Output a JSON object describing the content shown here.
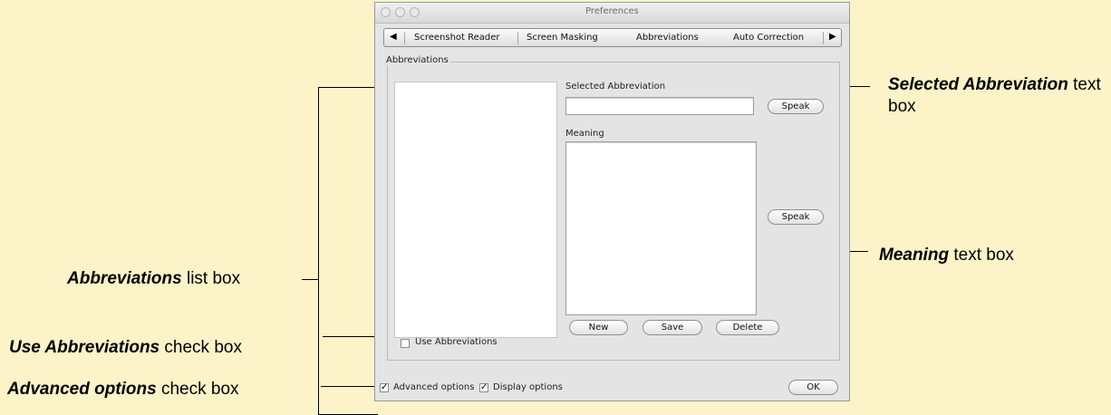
{
  "window": {
    "title": "Preferences",
    "tabs": [
      "Screenshot Reader",
      "Screen Masking",
      "Abbreviations",
      "Auto Correction"
    ],
    "tab_prev_icon": "◀",
    "tab_next_icon": "▶"
  },
  "group": {
    "label": "Abbreviations",
    "selected_label": "Selected Abbreviation",
    "selected_value": "",
    "meaning_label": "Meaning",
    "meaning_value": "",
    "speak_button": "Speak",
    "speak_button_2": "Speak",
    "new_button": "New",
    "save_button": "Save",
    "delete_button": "Delete",
    "use_abbreviations_label": "Use Abbreviations",
    "use_abbreviations_checked": false
  },
  "footer": {
    "advanced_label": "Advanced options",
    "advanced_checked": true,
    "display_label": "Display options",
    "display_checked": true,
    "ok_button": "OK"
  },
  "callouts": {
    "selected_bold": "Selected Abbreviation",
    "selected_rest": "text box",
    "meaning_bold": "Meaning",
    "meaning_rest": "text box",
    "abbrev_bold": "Abbreviations",
    "abbrev_rest": "list box",
    "use_bold": "Use Abbreviations",
    "use_rest": "check box",
    "advanced_bold": "Advanced options",
    "advanced_rest": "check box"
  },
  "colors": {
    "background": "#fdf3c8",
    "window": "#e4e4e4"
  }
}
